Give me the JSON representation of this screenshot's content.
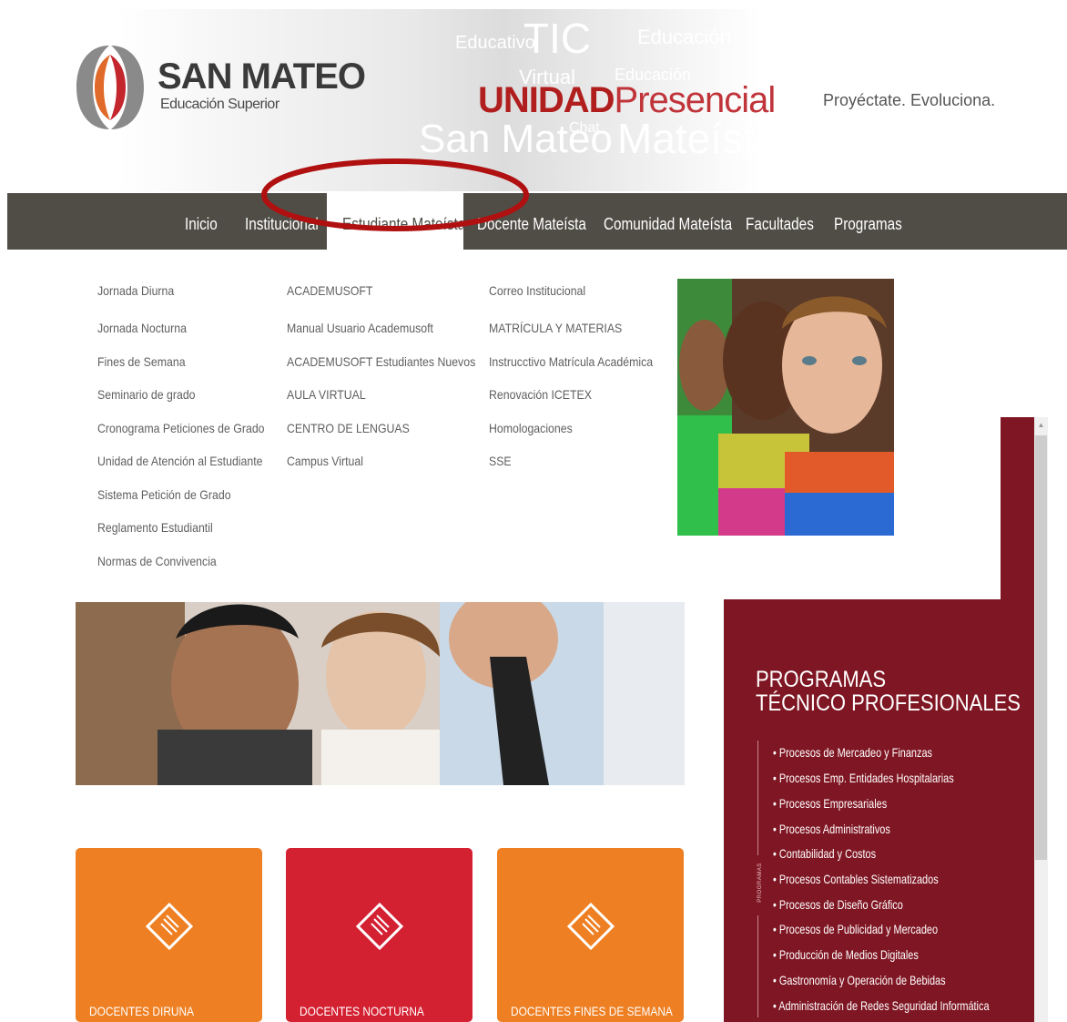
{
  "header": {
    "brand_name": "SAN MATEO",
    "brand_sub": "Educación Superior",
    "unidad_strong": "UNIDAD",
    "unidad_light": "Presencial",
    "tagline": "Proyéctate. Evoluciona.",
    "watermark": [
      "TIC",
      "Educación",
      "Virtual",
      "Educativo",
      "San Mateo",
      "Mateísta",
      "Chat",
      "Educación"
    ]
  },
  "nav": {
    "items": [
      "Inicio",
      "Institucional",
      "Estudiante Mateísta",
      "Docente Mateísta",
      "Comunidad Mateísta",
      "Facultades",
      "Programas"
    ],
    "active_index": 2
  },
  "dropdown": {
    "col1": [
      "Jornada Diurna",
      "Jornada Nocturna",
      "Fines de Semana",
      "Seminario de grado",
      "Cronograma Peticiones de Grado",
      "Unidad de Atención al Estudiante",
      "Sistema Petición de Grado",
      "Reglamento Estudiantil",
      "Normas de Convivencia"
    ],
    "col2": [
      "ACADEMUSOFT",
      "Manual Usuario Academusoft",
      "ACADEMUSOFT Estudiantes Nuevos",
      "AULA VIRTUAL",
      "CENTRO DE LENGUAS",
      "Campus Virtual"
    ],
    "col3": [
      "Correo Institucional",
      "MATRÍCULA Y MATERIAS",
      "Instrucctivo Matrícula Académica",
      "Renovación ICETEX",
      "Homologaciones",
      "SSE"
    ]
  },
  "cards": [
    {
      "label": "DOCENTES DIRUNA",
      "color": "#ee7f22"
    },
    {
      "label": "DOCENTES NOCTURNA",
      "color": "#d42132"
    },
    {
      "label": "DOCENTES FINES DE SEMANA",
      "color": "#ee7f22"
    }
  ],
  "panel": {
    "title_line1": "PROGRAMAS",
    "title_line2": "TÉCNICO PROFESIONALES",
    "vertical_label": "PROGRAMAS",
    "programs": [
      "• Procesos de Mercadeo y Finanzas",
      "• Procesos Emp. Entidades Hospitalarias",
      "• Procesos Empresariales",
      "• Procesos Administrativos",
      "• Contabilidad y Costos",
      "• Procesos Contables Sistematizados",
      "• Procesos de Diseño Gráfico",
      "• Procesos de Publicidad y Mercadeo",
      "• Producción de Medios Digitales",
      "• Gastronomía y Operación de Bebidas",
      "• Administración de Redes Seguridad Informática"
    ],
    "color": "#7f1623"
  },
  "colors": {
    "nav_bg": "#4f4d45",
    "highlight": "#b01010"
  },
  "icons": {
    "card_icon": "document-icon",
    "scroll_up": "scroll-up-arrow-icon"
  }
}
